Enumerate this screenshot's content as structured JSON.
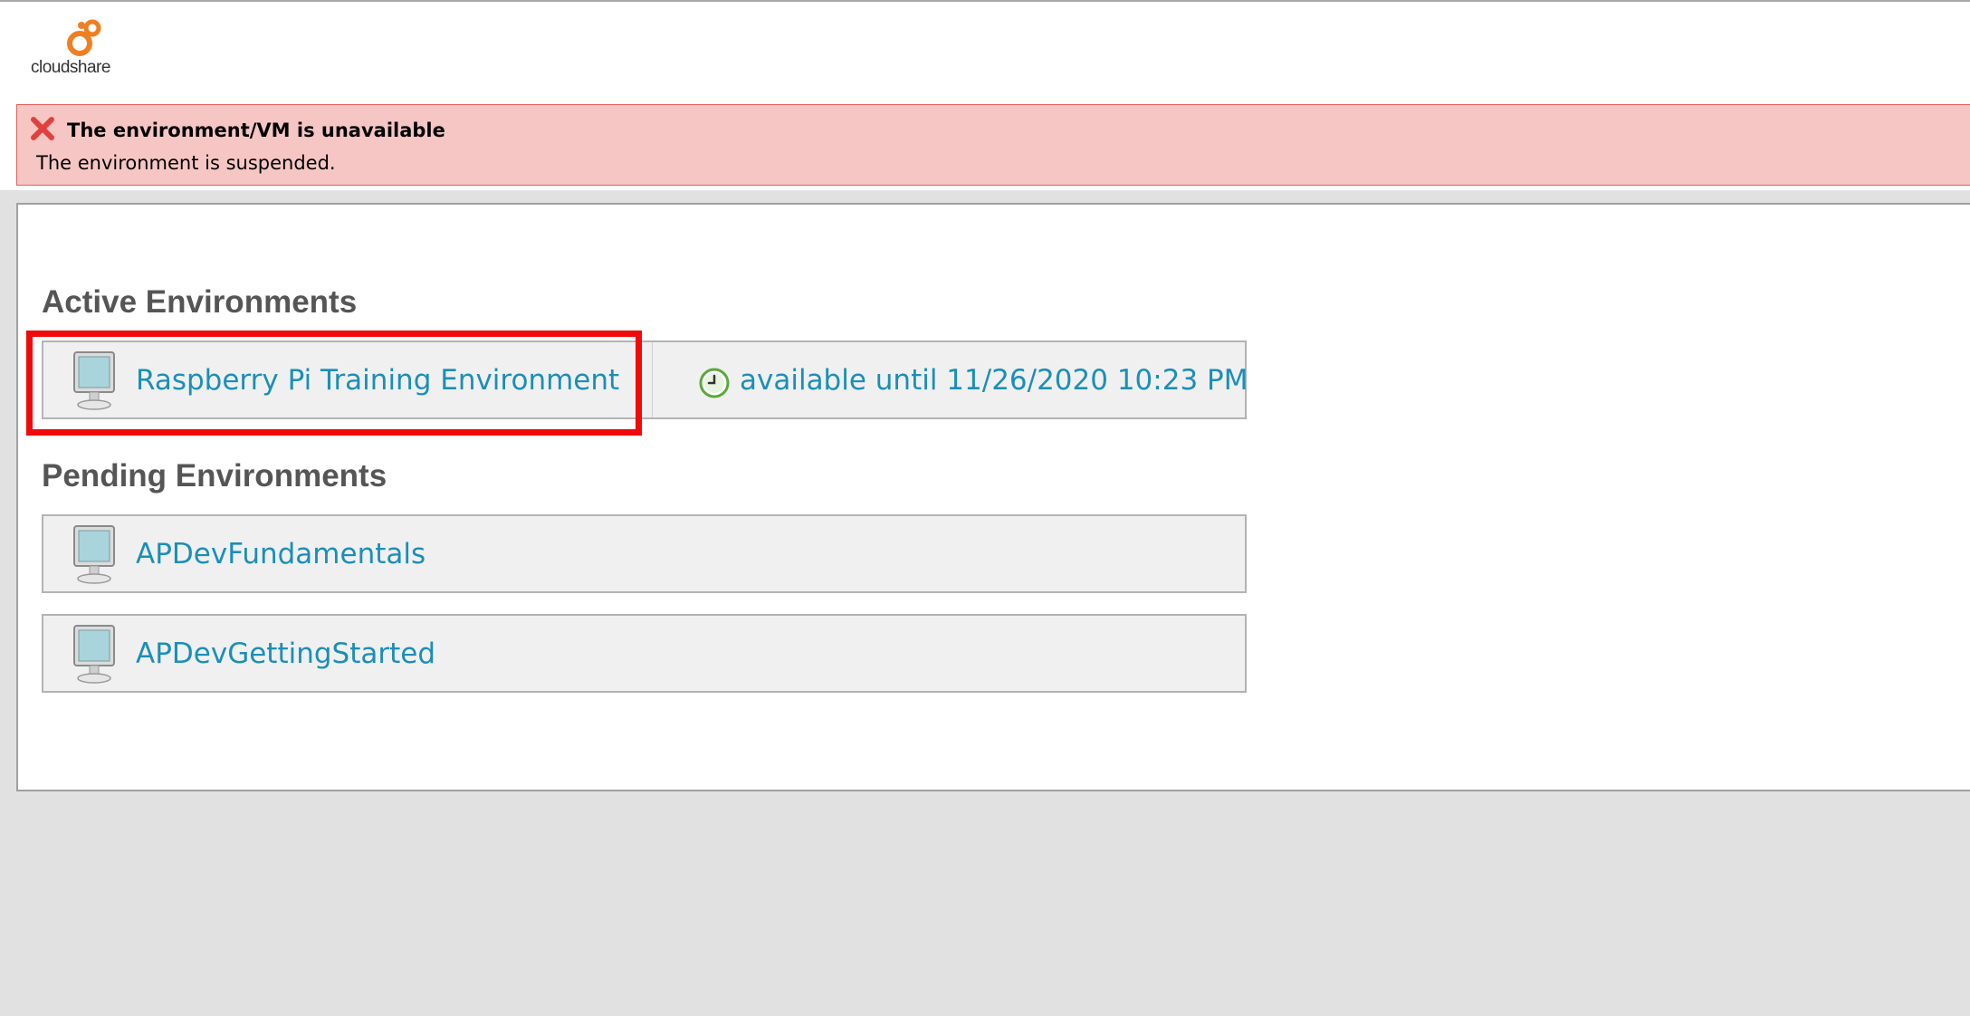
{
  "brand": {
    "logo_text": "cloudshare",
    "accent_color": "#f07f22"
  },
  "error": {
    "title": "The environment/VM is unavailable",
    "message": "The environment is suspended.",
    "icon": "close-x-icon",
    "color": "#e2403d"
  },
  "active": {
    "heading": "Active Environments",
    "environments": [
      {
        "name": "Raspberry Pi Training Environment",
        "availability": "available until 11/26/2020 10:23 PM",
        "icon": "monitor-icon",
        "status_icon": "clock-icon"
      }
    ]
  },
  "pending": {
    "heading": "Pending Environments",
    "environments": [
      {
        "name": "APDevFundamentals",
        "icon": "monitor-icon"
      },
      {
        "name": "APDevGettingStarted",
        "icon": "monitor-icon"
      }
    ]
  },
  "colors": {
    "link": "#1a8fb8",
    "heading": "#555555",
    "highlight": "#f00a0a",
    "banner_bg": "#f6c6c4"
  }
}
